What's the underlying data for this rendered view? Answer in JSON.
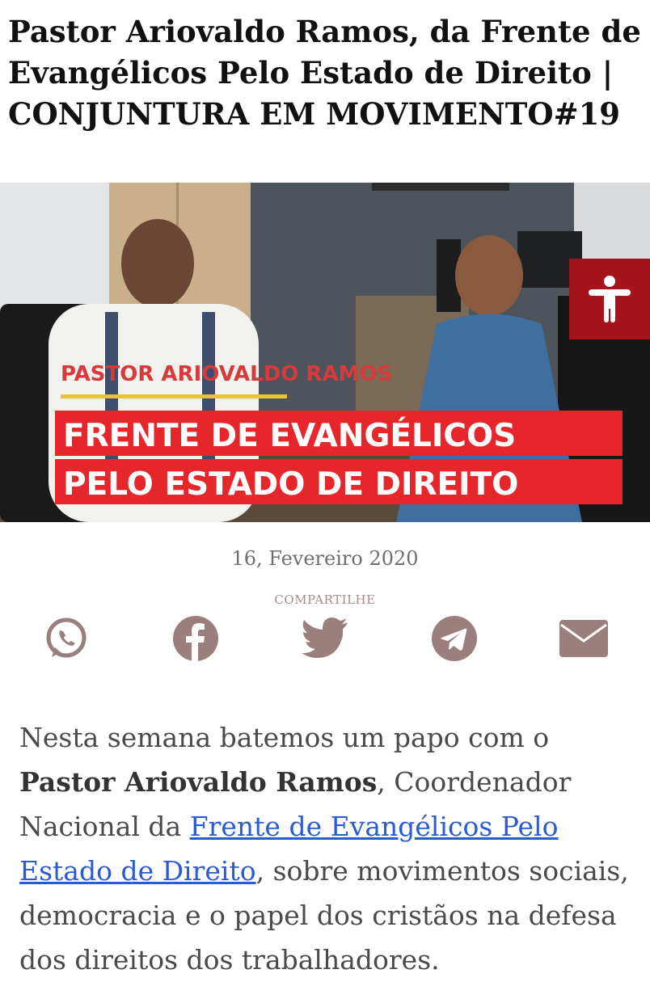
{
  "article": {
    "title": "Pastor Ariovaldo Ramos, da Frente de Evangélicos Pelo Estado de Direito | CONJUNTURA EM MOVIMENTO#19",
    "date": "16, Fevereiro 2020",
    "share_label": "COMPARTILHE",
    "share_icons": [
      "whatsapp-icon",
      "facebook-icon",
      "twitter-icon",
      "telegram-icon",
      "email-icon"
    ],
    "body": {
      "intro": "Nesta semana batemos um papo com o ",
      "bold_name": "Pastor Ariovaldo Ramos",
      "after_name": ", Coordenador Nacional da ",
      "link_text": "Frente de Evangélicos Pelo Estado de Direito",
      "rest": ", sobre movimentos sociais, democracia e o papel dos cristãos na defesa dos direitos dos trabalhadores."
    }
  },
  "hero": {
    "name_caption": "PASTOR ARIOVALDO RAMOS",
    "banner_line1": "FRENTE DE EVANGÉLICOS",
    "banner_line2": "PELO ESTADO DE DIREITO"
  },
  "accessibility": {
    "icon": "accessibility-icon"
  },
  "colors": {
    "accent_red": "#a5141b",
    "banner_red": "#e5262a",
    "caption_red": "#d63a3a",
    "share_icon": "#9b7e7e",
    "link": "#2a5bd7"
  }
}
